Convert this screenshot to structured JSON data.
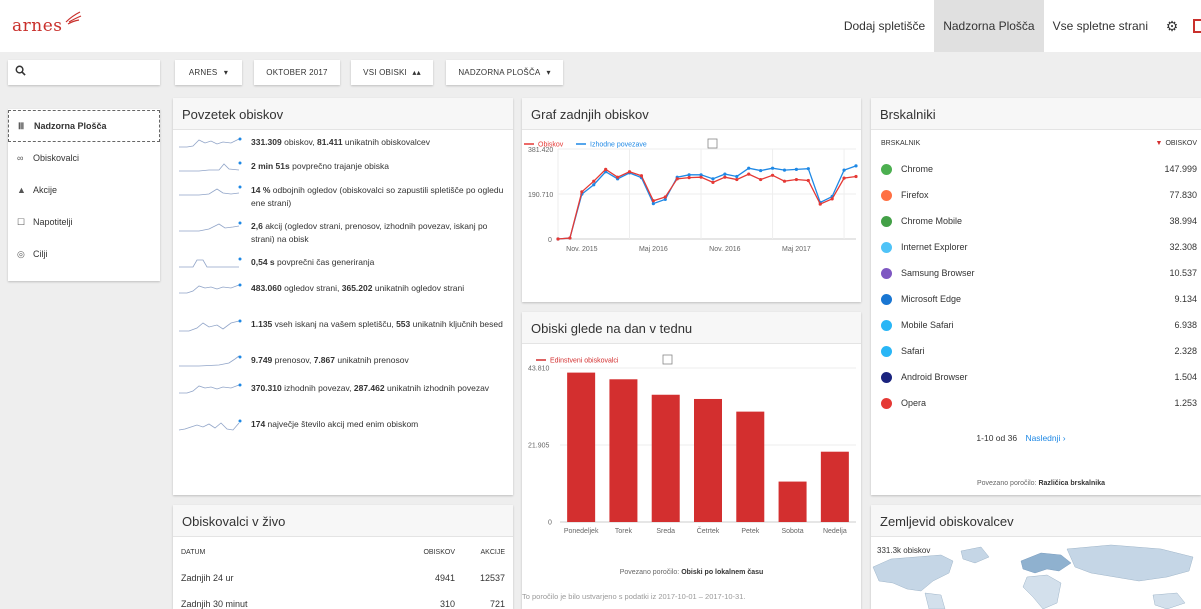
{
  "logo": "arnes",
  "nav": {
    "add_site": "Dodaj spletišče",
    "dashboard": "Nadzorna Plošča",
    "all_sites": "Vse spletne strani"
  },
  "filters": {
    "search_placeholder": "",
    "site": "ARNES",
    "site_caret": "▾",
    "period": "OKTOBER 2017",
    "segment": "VSI OBISKI",
    "view": "NADZORNA PLOŠČA",
    "view_caret": "▾"
  },
  "sidebar": {
    "items": [
      {
        "label": "Nadzorna Plošča",
        "icon": "grid-icon"
      },
      {
        "label": "Obiskovalci",
        "icon": "visitors-icon"
      },
      {
        "label": "Akcije",
        "icon": "bell-icon"
      },
      {
        "label": "Napotitelji",
        "icon": "referrers-icon"
      },
      {
        "label": "Cilji",
        "icon": "target-icon"
      }
    ]
  },
  "summary": {
    "title": "Povzetek obiskov",
    "rows": [
      {
        "v1": "331.309",
        "t1": " obiskov, ",
        "v2": "81.411",
        "t2": " unikatnih obiskovalcev"
      },
      {
        "v1": "2 min 51s",
        "t1": " povprečno trajanje obiska",
        "v2": "",
        "t2": ""
      },
      {
        "v1": "14 %",
        "t1": " odbojnih ogledov (obiskovalci so zapustili spletišče po ogledu ene strani)",
        "v2": "",
        "t2": ""
      },
      {
        "v1": "2,6",
        "t1": " akcij (ogledov strani, prenosov, izhodnih povezav, iskanj po strani) na obisk",
        "v2": "",
        "t2": ""
      },
      {
        "v1": "0,54 s",
        "t1": " povprečni čas generiranja",
        "v2": "",
        "t2": ""
      },
      {
        "v1": "483.060",
        "t1": " ogledov strani, ",
        "v2": "365.202",
        "t2": " unikatnih ogledov strani"
      },
      {
        "v1": "1.135",
        "t1": " vseh iskanj na vašem spletišču, ",
        "v2": "553",
        "t2": " unikatnih ključnih besed"
      },
      {
        "v1": "9.749",
        "t1": " prenosov, ",
        "v2": "7.867",
        "t2": " unikatnih prenosov"
      },
      {
        "v1": "370.310",
        "t1": " izhodnih povezav, ",
        "v2": "287.462",
        "t2": " unikatnih izhodnih povezav"
      },
      {
        "v1": "174",
        "t1": " največje število akcij med enim obiskom",
        "v2": "",
        "t2": ""
      }
    ]
  },
  "live": {
    "title": "Obiskovalci v živo",
    "headers": [
      "DATUM",
      "OBISKOV",
      "AKCIJE"
    ],
    "rows": [
      {
        "date": "Zadnjih 24 ur",
        "visits": "4941",
        "actions": "12537"
      },
      {
        "date": "Zadnjih 30 minut",
        "visits": "310",
        "actions": "721"
      }
    ]
  },
  "graph": {
    "title": "Graf zadnjih obiskov",
    "legend_visits": "Obiskov",
    "legend_exits": "Izhodne povezave",
    "y_top": "381.420",
    "y_mid": "190.710",
    "y_zero": "0",
    "x_labels": [
      "Nov. 2015",
      "Maj 2016",
      "Nov. 2016",
      "Maj 2017"
    ]
  },
  "weekday": {
    "title": "Obiski glede na dan v tednu",
    "legend": "Edinstveni obiskovalci",
    "related_label": "Povezano poročilo:",
    "related_link": "Obiski po lokalnem času",
    "generated": "To poročilo je bilo ustvarjeno s podatki iz 2017-10-01 – 2017-10-31."
  },
  "browsers": {
    "title": "Brskalniki",
    "col_name": "BRSKALNIK",
    "col_visits": "OBISKOV",
    "rows": [
      {
        "name": "Chrome",
        "visits": "147.999",
        "color": "#4caf50"
      },
      {
        "name": "Firefox",
        "visits": "77.830",
        "color": "#ff7043"
      },
      {
        "name": "Chrome Mobile",
        "visits": "38.994",
        "color": "#43a047"
      },
      {
        "name": "Internet Explorer",
        "visits": "32.308",
        "color": "#4fc3f7"
      },
      {
        "name": "Samsung Browser",
        "visits": "10.537",
        "color": "#7e57c2"
      },
      {
        "name": "Microsoft Edge",
        "visits": "9.134",
        "color": "#1976d2"
      },
      {
        "name": "Mobile Safari",
        "visits": "6.938",
        "color": "#29b6f6"
      },
      {
        "name": "Safari",
        "visits": "2.328",
        "color": "#29b6f6"
      },
      {
        "name": "Android Browser",
        "visits": "1.504",
        "color": "#1a237e"
      },
      {
        "name": "Opera",
        "visits": "1.253",
        "color": "#e53935"
      }
    ],
    "pagination": "1-10 od 36",
    "next": "Naslednji ›",
    "related_label": "Povezano poročilo:",
    "related_link": "Različica brskalnika"
  },
  "map": {
    "title": "Zemljevid obiskovalcev",
    "summary": "331.3k obiskov"
  },
  "chart_data": [
    {
      "type": "line",
      "title": "Graf zadnjih obiskov",
      "ylim": [
        0,
        381420
      ],
      "x": [
        "2015-09",
        "2015-10",
        "2015-11",
        "2015-12",
        "2016-01",
        "2016-02",
        "2016-03",
        "2016-04",
        "2016-05",
        "2016-06",
        "2016-07",
        "2016-08",
        "2016-09",
        "2016-10",
        "2016-11",
        "2016-12",
        "2017-01",
        "2017-02",
        "2017-03",
        "2017-04",
        "2017-05",
        "2017-06",
        "2017-07",
        "2017-08",
        "2017-09",
        "2017-10"
      ],
      "series": [
        {
          "name": "Obiskov",
          "color": "#e53935",
          "values": [
            0,
            4000,
            200000,
            245000,
            295000,
            262000,
            285000,
            268000,
            162000,
            178000,
            255000,
            260000,
            262000,
            240000,
            262000,
            252000,
            275000,
            252000,
            270000,
            245000,
            252000,
            248000,
            148000,
            170000,
            258000,
            265000
          ]
        },
        {
          "name": "Izhodne povezave",
          "color": "#1e88e5",
          "values": [
            0,
            4000,
            190000,
            230000,
            285000,
            255000,
            280000,
            260000,
            150000,
            168000,
            262000,
            272000,
            272000,
            255000,
            275000,
            265000,
            300000,
            290000,
            300000,
            292000,
            295000,
            298000,
            155000,
            180000,
            292000,
            310000
          ]
        }
      ]
    },
    {
      "type": "bar",
      "title": "Obiski glede na dan v tednu",
      "categories": [
        "Ponedeljek",
        "Torek",
        "Sreda",
        "Četrtek",
        "Petek",
        "Sobota",
        "Nedelja"
      ],
      "series": [
        {
          "name": "Edinstveni obiskovalci",
          "color": "#d32f2f",
          "values": [
            42500,
            40600,
            36200,
            35000,
            31400,
            11500,
            20000
          ]
        }
      ],
      "yticks": [
        "43.810",
        "21.905",
        "0"
      ],
      "ylim": [
        0,
        43810
      ]
    }
  ]
}
